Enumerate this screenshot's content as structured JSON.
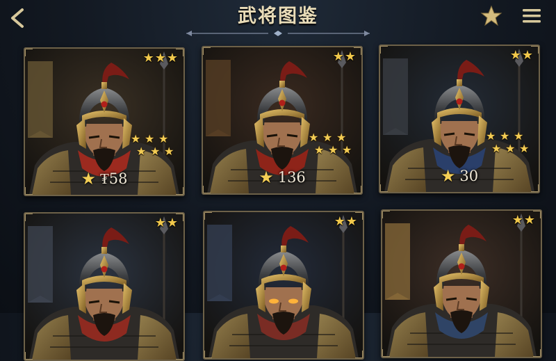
{
  "header": {
    "title": "武将图鉴",
    "back_icon": "back-arrow-icon",
    "favorite_icon": "star-icon",
    "menu_icon": "hamburger-menu-icon"
  },
  "colors": {
    "accent_gold": "#f1c84b",
    "frame": "#6d6148",
    "title_text": "#e9dcb8"
  },
  "generals": [
    {
      "rarity": 3,
      "rank_stars": 6,
      "power": "₮58",
      "scarf": "#9c2a1f",
      "bg": "#3a3024",
      "banner": "#6b5a36"
    },
    {
      "rarity": 2,
      "rank_stars": 6,
      "power": "136",
      "scarf": "#8e2419",
      "bg": "#3a2a20",
      "banner": "#5a4026"
    },
    {
      "rarity": 2,
      "rank_stars": 6,
      "power": "30",
      "scarf": "#2a3f6a",
      "bg": "#232b36",
      "banner": "#3b3f46"
    },
    {
      "rarity": 2,
      "rank_stars": 0,
      "power": "",
      "scarf": "#8e2a20",
      "bg": "#2b3340",
      "banner": "#3f4652"
    },
    {
      "rarity": 2,
      "rank_stars": 0,
      "power": "",
      "scarf": "#7a2c24",
      "bg": "#232b3a",
      "banner": "#364054",
      "glow_eyes": true
    },
    {
      "rarity": 2,
      "rank_stars": 0,
      "power": "",
      "scarf": "#2f4466",
      "bg": "#3d2e26",
      "banner": "#8a6b3a"
    }
  ]
}
